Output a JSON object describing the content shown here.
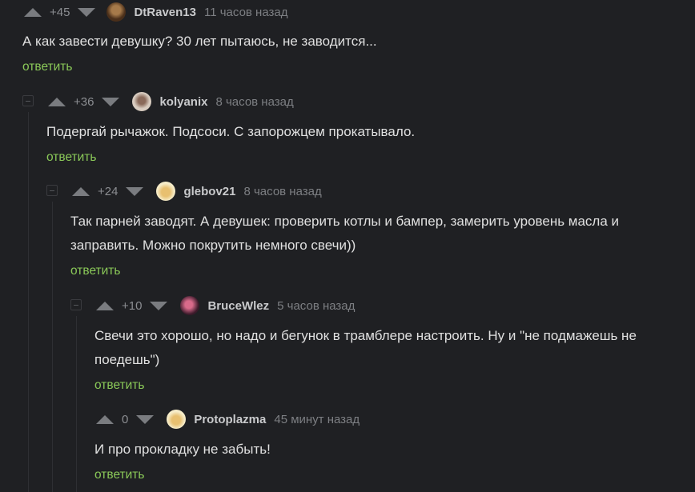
{
  "comments": [
    {
      "rating": "+45",
      "username": "DtRaven13",
      "time": "11 часов назад",
      "text": "А как завести девушку? 30 лет пытаюсь, не заводится...",
      "reply": "ответить",
      "avatar_color": "#6b4a2e"
    },
    {
      "rating": "+36",
      "username": "kolyanix",
      "time": "8 часов назад",
      "text": "Подергай рычажок. Подсоси. С запорожцем прокатывало.",
      "reply": "ответить",
      "avatar_color": "#b8a89a"
    },
    {
      "rating": "+24",
      "username": "glebov21",
      "time": "8 часов назад",
      "text_line1": "Так парней заводят. А девушек: проверить котлы и бампер, замерить уровень масла и",
      "text_line2": "заправить. Можно покрутить немного свечи))",
      "reply": "ответить",
      "avatar_color": "#f2e3b0"
    },
    {
      "rating": "+10",
      "username": "BruceWlez",
      "time": "5 часов назад",
      "text_line1": "Свечи это хорошо, но надо и бегунок в трамблере настроить. Ну и \"не подмажешь не",
      "text_line2": "поедешь\")",
      "reply": "ответить",
      "avatar_color": "#8a3a5a"
    },
    {
      "rating": "0",
      "username": "Protoplazma",
      "time": "45 минут назад",
      "text": "И про прокладку не забыть!",
      "reply": "ответить",
      "avatar_color": "#f2e3b0"
    }
  ],
  "colors": {
    "background": "#1f2023",
    "reply_link": "#8ac858",
    "vote_arrow": "#7a7c80"
  }
}
